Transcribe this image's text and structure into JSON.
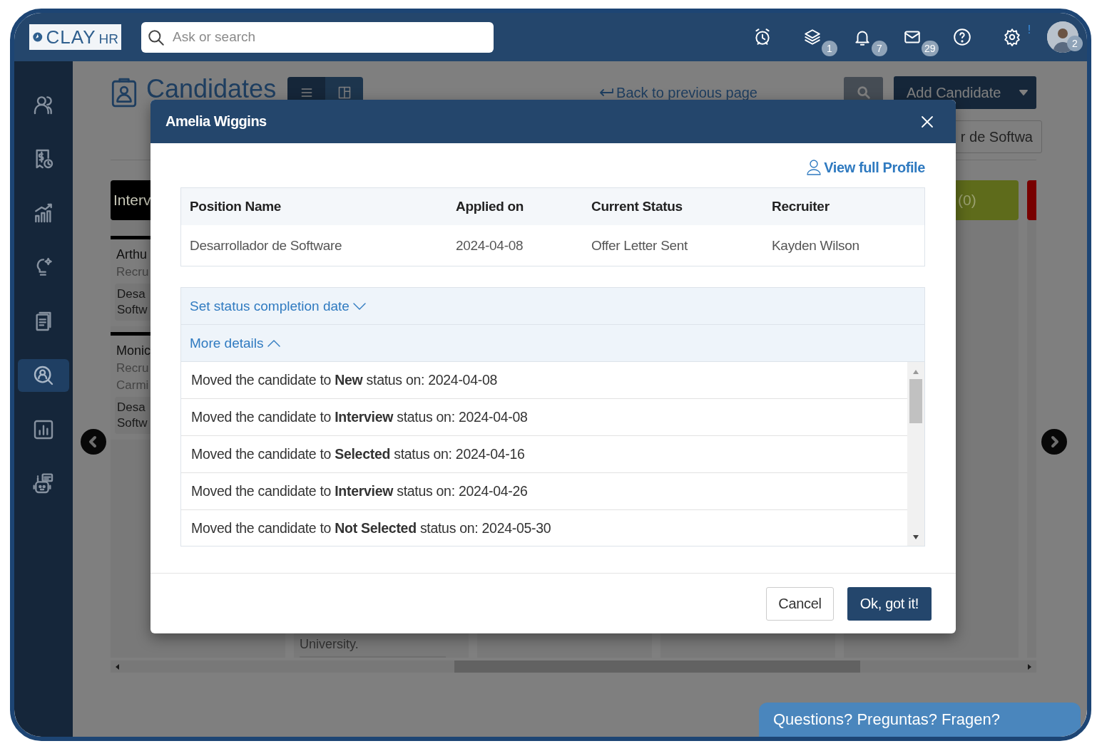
{
  "header": {
    "logo": {
      "main": "CLAY",
      "sub": "HR"
    },
    "search": {
      "placeholder": "Ask or search"
    },
    "icons": [
      {
        "kind": "alarm"
      },
      {
        "kind": "layers",
        "badge": {
          "text": "1",
          "kind": "count"
        }
      },
      {
        "kind": "bell",
        "badge": {
          "text": "7",
          "kind": "count"
        }
      },
      {
        "kind": "mail",
        "badge": {
          "text": "29",
          "kind": "count"
        }
      },
      {
        "kind": "help"
      },
      {
        "kind": "settings",
        "badge": {
          "text": "!",
          "kind": "alert"
        }
      }
    ],
    "avatar": {
      "badge": "2"
    }
  },
  "sidebar": {
    "items": [
      {
        "kind": "people",
        "selected": false
      },
      {
        "kind": "payroll",
        "selected": false
      },
      {
        "kind": "growth",
        "selected": false
      },
      {
        "kind": "idea",
        "selected": false
      },
      {
        "kind": "document",
        "selected": false
      },
      {
        "kind": "candidate-search",
        "selected": true
      },
      {
        "kind": "report",
        "selected": false
      },
      {
        "kind": "bot",
        "selected": false
      }
    ]
  },
  "page": {
    "title": "Candidates",
    "view_toggle": [
      {
        "kind": "list",
        "selected": false
      },
      {
        "kind": "board",
        "selected": true
      }
    ],
    "back_link": "Back to previous page",
    "add_button": "Add Candidate",
    "position_filter": "r de Softwa",
    "columns": [
      {
        "title": "Interv",
        "color": "#000000",
        "cards": [
          {
            "lines": [
              "Arthu",
              "Recru"
            ],
            "tag": [
              "Desa",
              "Softw"
            ]
          },
          {
            "lines": [
              "Monic",
              "Recru",
              "Carmi"
            ],
            "tag": [
              "Desa",
              "Softw"
            ]
          }
        ]
      },
      {
        "tail": "University."
      },
      {},
      {},
      {
        "title": "(0)",
        "color": "#5e6b1b"
      },
      {
        "color": "#780000"
      }
    ]
  },
  "modal": {
    "title": "Amelia Wiggins",
    "profile_link": "View full Profile",
    "table": {
      "columns": [
        "Position Name",
        "Applied on",
        "Current Status",
        "Recruiter"
      ],
      "rows": [
        [
          "Desarrollador de Software",
          "2024-04-08",
          "Offer Letter Sent",
          "Kayden Wilson"
        ]
      ]
    },
    "sections": [
      {
        "label": "Set status completion date",
        "expanded": false
      },
      {
        "label": "More details",
        "expanded": true
      }
    ],
    "history": [
      "Moved the candidate to **New** status on: 2024-04-08",
      "Moved the candidate to **Interview** status on: 2024-04-08",
      "Moved the candidate to **Selected** status on: 2024-04-16",
      "Moved the candidate to **Interview** status on: 2024-04-26",
      "Moved the candidate to **Not Selected** status on: 2024-05-30"
    ],
    "buttons": [
      {
        "label": "Cancel",
        "kind": "secondary"
      },
      {
        "label": "Ok, got it!",
        "kind": "primary"
      }
    ]
  },
  "chat": {
    "label": "Questions? Preguntas? Fragen?"
  }
}
